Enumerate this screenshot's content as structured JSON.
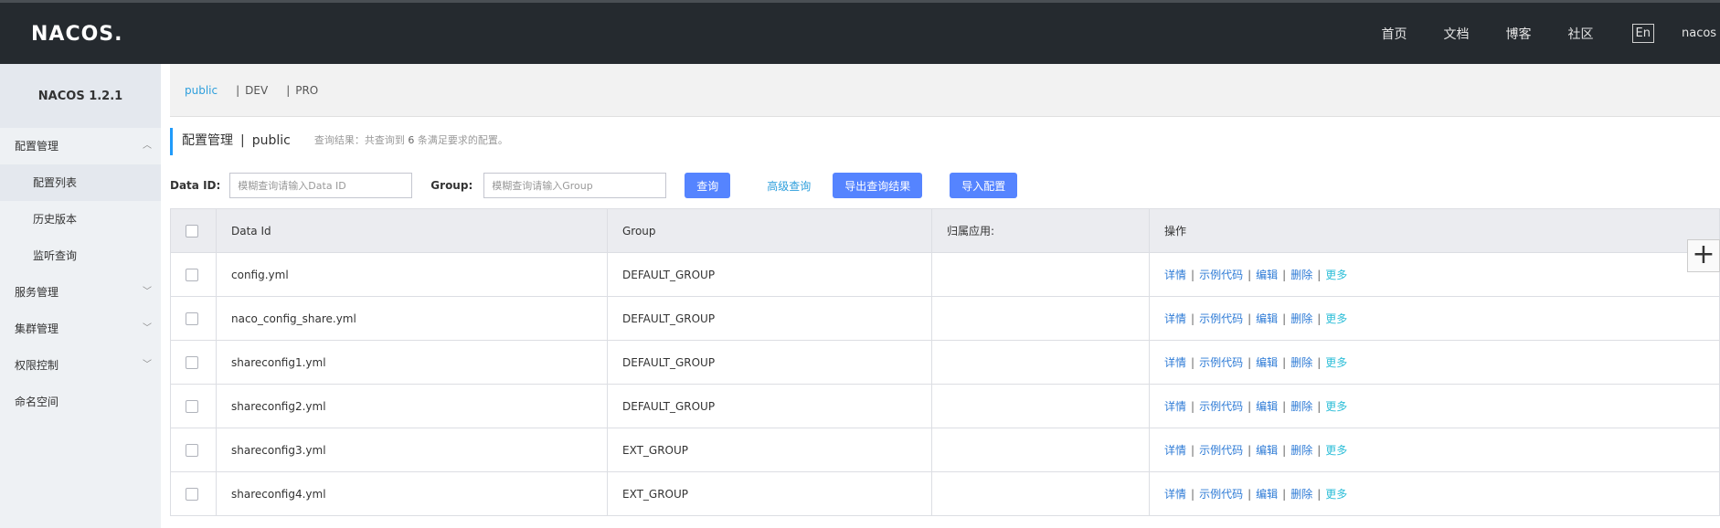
{
  "header": {
    "logo": "NACOS.",
    "nav": [
      "首页",
      "文档",
      "博客",
      "社区"
    ],
    "lang": "En",
    "user": "nacos"
  },
  "sidebar": {
    "title": "NACOS 1.2.1",
    "items": [
      {
        "label": "配置管理",
        "expanded": true
      },
      {
        "label": "配置列表",
        "sub": true,
        "active": true
      },
      {
        "label": "历史版本",
        "sub": true
      },
      {
        "label": "监听查询",
        "sub": true
      },
      {
        "label": "服务管理"
      },
      {
        "label": "集群管理"
      },
      {
        "label": "权限控制"
      },
      {
        "label": "命名空间"
      }
    ]
  },
  "namespaces": {
    "items": [
      "public",
      "DEV",
      "PRO"
    ],
    "active": "public"
  },
  "page": {
    "title": "配置管理",
    "namespace": "public",
    "query_prefix": "查询结果：共查询到",
    "query_count": "6",
    "query_suffix": "条满足要求的配置。"
  },
  "search": {
    "dataid_label": "Data ID:",
    "dataid_placeholder": "模糊查询请输入Data ID",
    "group_label": "Group:",
    "group_placeholder": "模糊查询请输入Group",
    "query_button": "查询",
    "advanced_link": "高级查询",
    "export_button": "导出查询结果",
    "import_button": "导入配置"
  },
  "table": {
    "headers": [
      "Data Id",
      "Group",
      "归属应用:",
      "操作"
    ],
    "rows": [
      {
        "data_id": "config.yml",
        "group": "DEFAULT_GROUP",
        "app": ""
      },
      {
        "data_id": "naco_config_share.yml",
        "group": "DEFAULT_GROUP",
        "app": ""
      },
      {
        "data_id": "shareconfig1.yml",
        "group": "DEFAULT_GROUP",
        "app": ""
      },
      {
        "data_id": "shareconfig2.yml",
        "group": "DEFAULT_GROUP",
        "app": ""
      },
      {
        "data_id": "shareconfig3.yml",
        "group": "EXT_GROUP",
        "app": ""
      },
      {
        "data_id": "shareconfig4.yml",
        "group": "EXT_GROUP",
        "app": ""
      }
    ],
    "ops": {
      "detail": "详情",
      "sample": "示例代码",
      "edit": "编辑",
      "delete": "删除",
      "more": "更多"
    }
  },
  "colors": {
    "topbar": "#252a2f",
    "primary_button": "#5584ff",
    "link": "#2e7bd6",
    "accent": "#209bfa"
  }
}
